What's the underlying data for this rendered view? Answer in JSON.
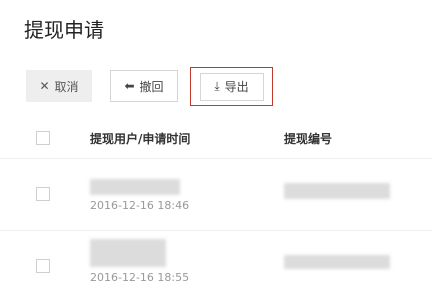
{
  "page": {
    "title": "提现申请"
  },
  "toolbar": {
    "cancel_label": "取消",
    "undo_label": "撤回",
    "export_label": "导出"
  },
  "table": {
    "columns": [
      "提现用户/申请时间",
      "提现编号"
    ],
    "rows": [
      {
        "time": "2016-12-16 18:46"
      },
      {
        "time": "2016-12-16 18:55"
      }
    ]
  }
}
